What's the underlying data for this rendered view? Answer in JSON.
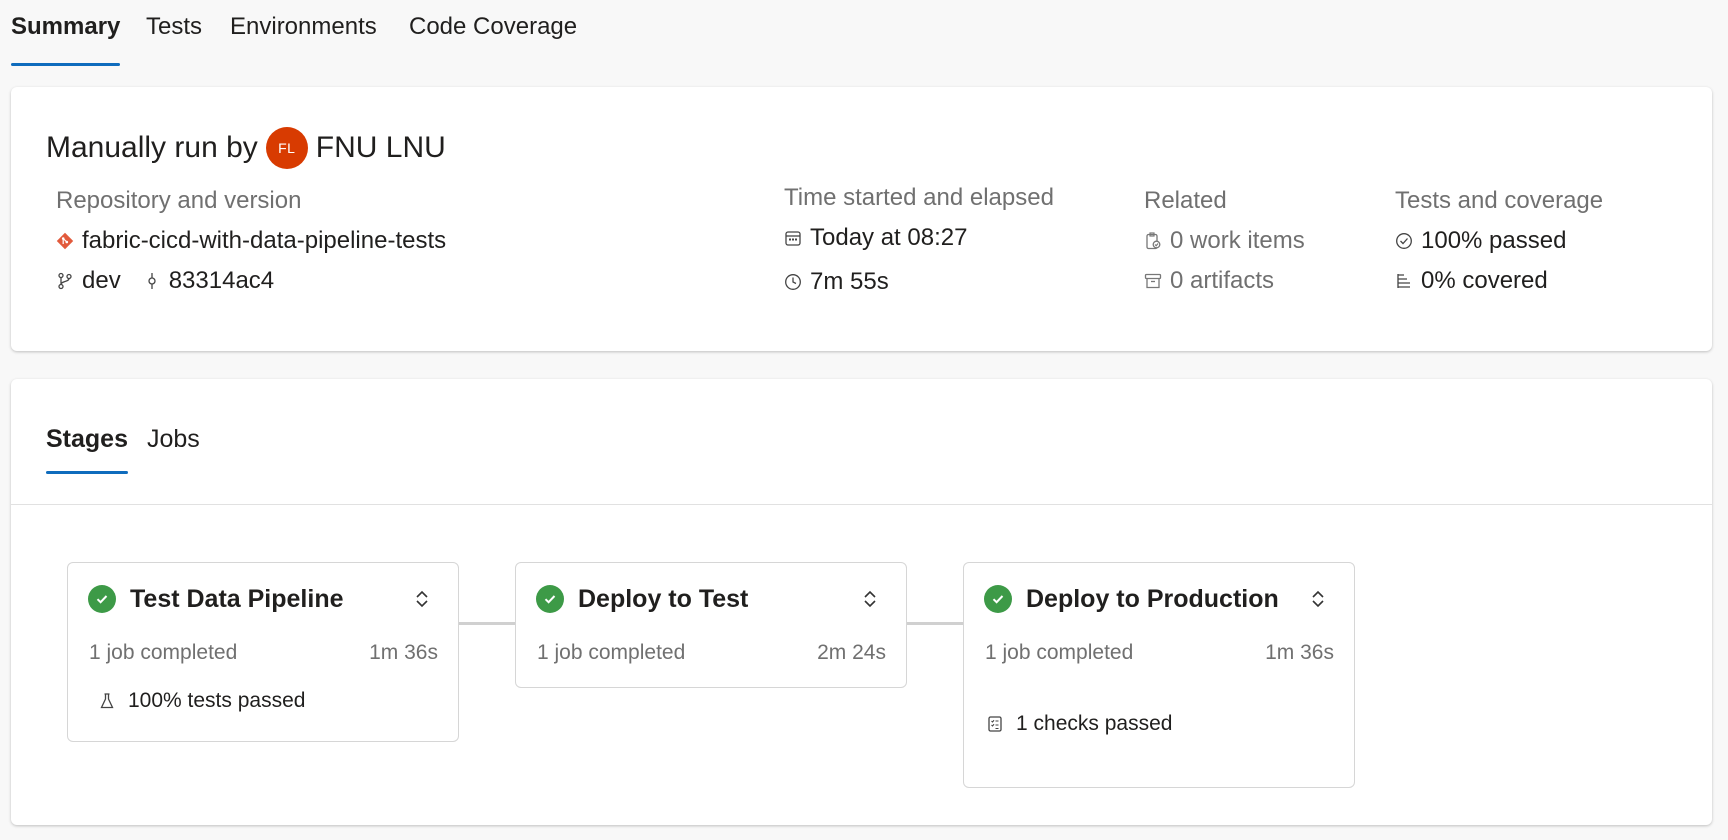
{
  "tabs": [
    "Summary",
    "Tests",
    "Environments",
    "Code Coverage"
  ],
  "run": {
    "title_prefix": "Manually run by",
    "avatar_initials": "FL",
    "avatar_color": "#d83b01",
    "user": "FNU LNU"
  },
  "repository": {
    "label": "Repository and version",
    "name": "fabric-cicd-with-data-pipeline-tests",
    "branch": "dev",
    "commit": "83314ac4"
  },
  "time": {
    "label": "Time started and elapsed",
    "started": "Today at 08:27",
    "elapsed": "7m 55s"
  },
  "related": {
    "label": "Related",
    "work_items": "0 work items",
    "artifacts": "0 artifacts"
  },
  "tests": {
    "label": "Tests and coverage",
    "passed": "100% passed",
    "covered": "0% covered"
  },
  "stage_tabs": [
    "Stages",
    "Jobs"
  ],
  "stages": [
    {
      "name": "Test Data Pipeline",
      "jobs": "1 job completed",
      "duration": "1m 36s",
      "extra": "100% tests passed",
      "extra_icon": "beaker-icon"
    },
    {
      "name": "Deploy to Test",
      "jobs": "1 job completed",
      "duration": "2m 24s"
    },
    {
      "name": "Deploy to Production",
      "jobs": "1 job completed",
      "duration": "1m 36s",
      "extra": "1 checks passed",
      "extra_icon": "checklist-icon"
    }
  ],
  "colors": {
    "accent": "#0f6cbd",
    "success": "#3d9a47",
    "git": "#e25a3c"
  }
}
